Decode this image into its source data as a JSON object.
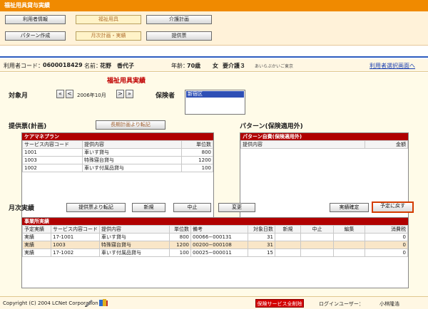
{
  "window": {
    "title": "福祉用具貸与実績"
  },
  "nav": {
    "row1": [
      "利用者情報",
      "福祉用具",
      "介護計画"
    ],
    "row2": [
      "パターン作成",
      "月次計画・実績",
      "提供票"
    ]
  },
  "user": {
    "code_label": "利用者コード：",
    "code": "0600018429",
    "name_label": "名前：",
    "name": "花野　香代子",
    "age_label": "年齢：",
    "age": "70歳",
    "gender": "女",
    "care_level": "要介護３",
    "furigana": "あいらぶかいご東京",
    "select_link": "利用者選択画面へ"
  },
  "page_title": "福祉用具実績",
  "target_month": {
    "label": "対象月",
    "first": "«",
    "prev": "<",
    "value": "2006年10月",
    "next": ">",
    "last": "»"
  },
  "insurer": {
    "label": "保険者",
    "options": [
      "新宿区"
    ],
    "selected": "新宿区"
  },
  "plan": {
    "heading": "提供票(計画)",
    "transfer_button": "長期計画より転記",
    "panel_title": "ケアマネプラン",
    "columns": [
      "サービス内容コード",
      "提供内容",
      "単位数"
    ],
    "rows": [
      [
        "1001",
        "車いす貸与",
        "800"
      ],
      [
        "1003",
        "特殊寝台貸与",
        "1200"
      ],
      [
        "1002",
        "車いす付属品貸与",
        "100"
      ]
    ]
  },
  "pattern": {
    "heading": "パターン(保険適用外)",
    "panel_title": "パターン自費(保険適用外)",
    "columns": [
      "提供内容",
      "金額"
    ]
  },
  "monthly": {
    "heading": "月次実績",
    "buttons": {
      "transfer": "提供票より転記",
      "new": "新規",
      "cancel": "中止",
      "change": "変更",
      "confirm": "実績確定",
      "revert": "予定に戻す"
    },
    "panel_title": "事業所実績",
    "columns": [
      "予定実績",
      "サービス内容コード",
      "提供内容",
      "単位数",
      "備考",
      "対象日数",
      "新規",
      "中止",
      "編集",
      "消費税"
    ],
    "rows": [
      [
        "実績",
        "17-1001",
        "車いす貸与",
        "800",
        "00066−000131",
        "31",
        "",
        "",
        "",
        "0"
      ],
      [
        "実績",
        "1003",
        "特殊寝台貸与",
        "1200",
        "00200−000108",
        "31",
        "",
        "",
        "",
        "0"
      ],
      [
        "実績",
        "17-1002",
        "車いす付属品貸与",
        "100",
        "00025−000011",
        "15",
        "",
        "",
        "",
        "0"
      ]
    ]
  },
  "footer": {
    "copyright": "Copyright (C) 2004 LCNet Corporation",
    "delete_button": "保険サービス全削除",
    "login_label": "ログインユーザー：",
    "login_user": "小林隆浩"
  }
}
